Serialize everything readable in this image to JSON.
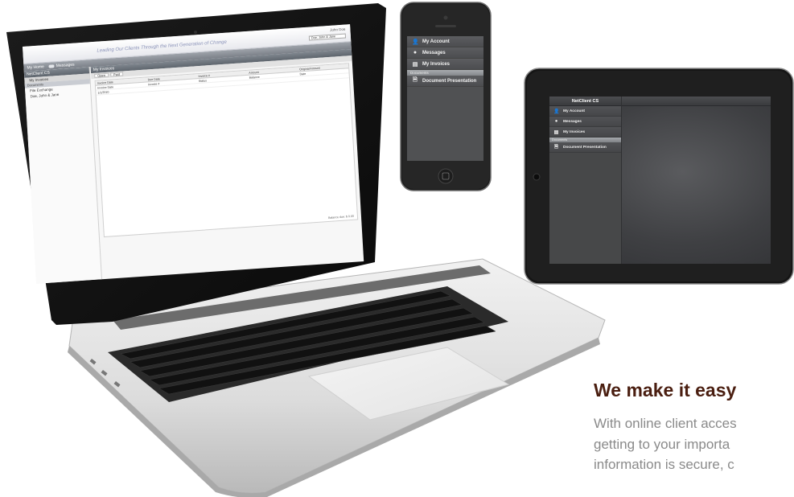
{
  "laptop_app": {
    "tagline": "Leading Our Clients Through the Next Generation of Change",
    "user_name": "John Doe",
    "client_selector": "Doe, John & Jane",
    "nav": {
      "home_label": "My Home",
      "messages_label": "Messages"
    },
    "sidebar": {
      "header": "NetClient CS",
      "items": [
        "My Invoices"
      ],
      "section_label": "Documents",
      "doc_items": [
        "File Exchange",
        "Doe, John & Jane"
      ]
    },
    "panel_title": "My Invoices",
    "tabs": [
      "Open",
      "Paid"
    ],
    "columns": [
      "Invoice Date",
      "Due Date",
      "Invoice #",
      "Amount",
      "Original Amount"
    ],
    "rows": [
      [
        "Invoice Date",
        "Invoice #",
        "Status",
        "Balance",
        "Date"
      ],
      [
        "1/1/2010",
        "",
        "",
        "",
        ""
      ]
    ],
    "footer_text": "Balance due: $ 0.00"
  },
  "phone_app": {
    "items": [
      {
        "icon": "person-icon",
        "label": "My Account"
      },
      {
        "icon": "speech-bubble-icon",
        "label": "Messages"
      },
      {
        "icon": "invoice-icon",
        "label": "My Invoices"
      }
    ],
    "section_label": "Documents",
    "doc_items": [
      {
        "icon": "document-icon",
        "label": "Document Presentation"
      }
    ]
  },
  "tablet_app": {
    "header": "NetClient CS",
    "items": [
      {
        "icon": "person-icon",
        "label": "My Account"
      },
      {
        "icon": "speech-bubble-icon",
        "label": "Messages"
      },
      {
        "icon": "invoice-icon",
        "label": "My Invoices"
      }
    ],
    "section_label": "Documents",
    "doc_items": [
      {
        "icon": "document-icon",
        "label": "Document Presentation"
      }
    ]
  },
  "promo": {
    "heading": "We make it easy",
    "lines": [
      "With online client acces",
      "getting to your importa",
      "information is secure, c"
    ]
  },
  "colors": {
    "heading": "#4a1e10",
    "body_text": "#8a8a8a",
    "app_dark": "#505153"
  }
}
